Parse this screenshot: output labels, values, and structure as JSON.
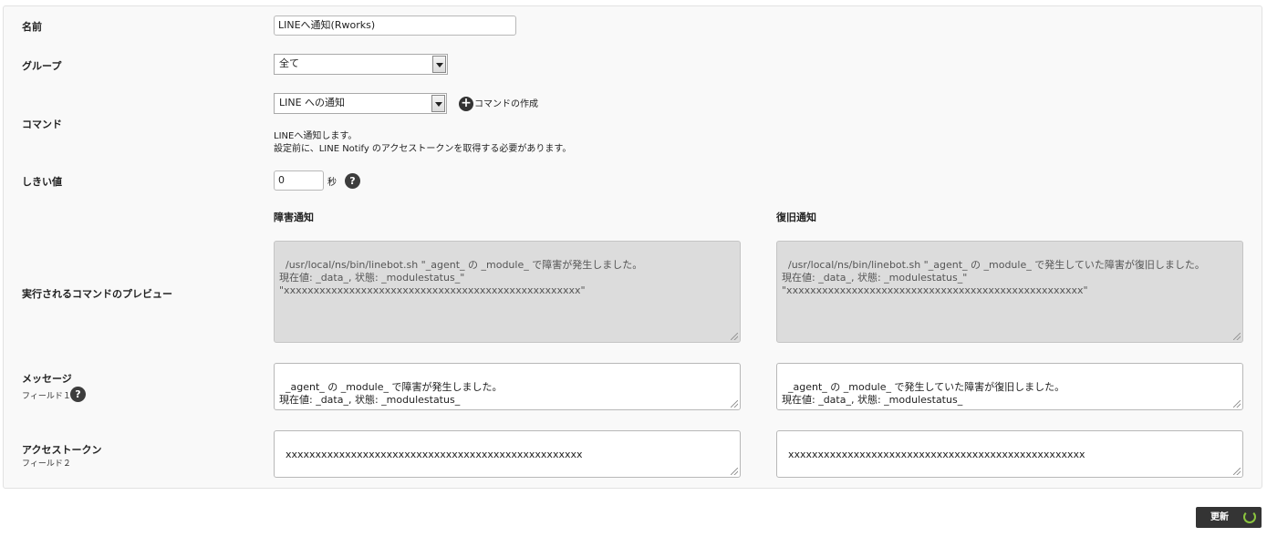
{
  "form": {
    "name": {
      "label": "名前",
      "value": "LINEへ通知(Rworks)"
    },
    "group": {
      "label": "グループ",
      "selected": "全て"
    },
    "command": {
      "label": "コマンド",
      "selected": "LINE への通知",
      "create_link": "コマンドの作成",
      "description_line1": "LINEへ通知します。",
      "description_line2": "設定前に、LINE Notify のアクセストークンを取得する必要があります。"
    },
    "threshold": {
      "label": "しきい値",
      "value": "0",
      "unit": "秒"
    },
    "columns": {
      "failure": "障害通知",
      "recovery": "復旧通知"
    },
    "preview": {
      "label": "実行されるコマンドのプレビュー",
      "failure": "/usr/local/ns/bin/linebot.sh \"_agent_ の _module_ で障害が発生しました。\n現在値: _data_, 状態: _modulestatus_\"\n\"xxxxxxxxxxxxxxxxxxxxxxxxxxxxxxxxxxxxxxxxxxxxxxxxxx\"",
      "recovery": "/usr/local/ns/bin/linebot.sh \"_agent_ の _module_ で発生していた障害が復旧しました。\n現在値: _data_, 状態: _modulestatus_\"\n\"xxxxxxxxxxxxxxxxxxxxxxxxxxxxxxxxxxxxxxxxxxxxxxxxxx\""
    },
    "message": {
      "label": "メッセージ",
      "sublabel": "フィールド１",
      "failure": "_agent_ の _module_ で障害が発生しました。\n現在値: _data_, 状態: _modulestatus_",
      "recovery": "_agent_ の _module_ で発生していた障害が復旧しました。\n現在値: _data_, 状態: _modulestatus_"
    },
    "token": {
      "label": "アクセストークン",
      "sublabel": "フィールド２",
      "failure": "xxxxxxxxxxxxxxxxxxxxxxxxxxxxxxxxxxxxxxxxxxxxxxxxxx",
      "recovery": "xxxxxxxxxxxxxxxxxxxxxxxxxxxxxxxxxxxxxxxxxxxxxxxxxx"
    },
    "help_glyph": "?",
    "plus_glyph": "+"
  },
  "actions": {
    "update_label": "更新"
  },
  "colors": {
    "accent": "#8cc63f",
    "button": "#343434"
  }
}
